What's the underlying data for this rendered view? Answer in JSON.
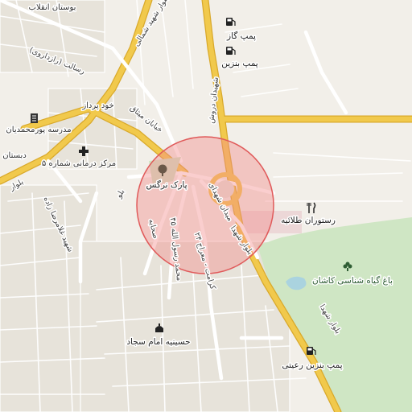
{
  "labels": {
    "bostan": "بوستان انقلاب",
    "pomp_gaz": "پمپ گاز",
    "pomp_benzin_top": "پمپ بنزین",
    "resalat": "رسالت (رازداروی)",
    "khod_pardaz": "خود پرداز",
    "meydan_mishagh": "خیابان میثاق",
    "madrese": "مدرسه پورمحمدیان",
    "markaz": "مرکز درمانی شماره ۵",
    "bolvar_shahid": "بلوار شهید",
    "shahid_gholamreza": "شهید غلامرضا زاده",
    "park_narges": "پارک نرگس",
    "meydan_shohada": "میدان شهدای",
    "dorosh": "شهیدان دروش",
    "bolvar_shohada_mid": "بلوار شهدا",
    "mohammad_rasool": "محمد رسول الله ۴۵",
    "karamat": "کرامت - معراج ۲۴",
    "sahabeh": "صحابه",
    "restoran": "رستوران طلائیه",
    "bagh": "باغ گیاه شناسی کاشان",
    "hosseinieh": "حسینیه امام سجاد",
    "pomp_rajabi": "پمپ بنزین رعیتی",
    "bolvar_shohada_right": "بلوار شهدا",
    "bolvar_left": "بلوار",
    "bolvar_shahid_top": "بلوار شهید شمالی",
    "dabestan": "دبستان",
    "bolvar_mid": "بلو"
  },
  "colors": {
    "background": "#f2efe9",
    "major_road": "#f1c94c",
    "green_area": "#cfe6c4",
    "highlight_circle": "#f28b8b"
  },
  "icons": {
    "fuel": "fuel-pump-icon",
    "medical": "medical-cross-icon",
    "school": "school-icon",
    "park": "tree-icon",
    "restaurant": "restaurant-icon",
    "garden": "flower-icon",
    "mosque": "mosque-icon"
  }
}
